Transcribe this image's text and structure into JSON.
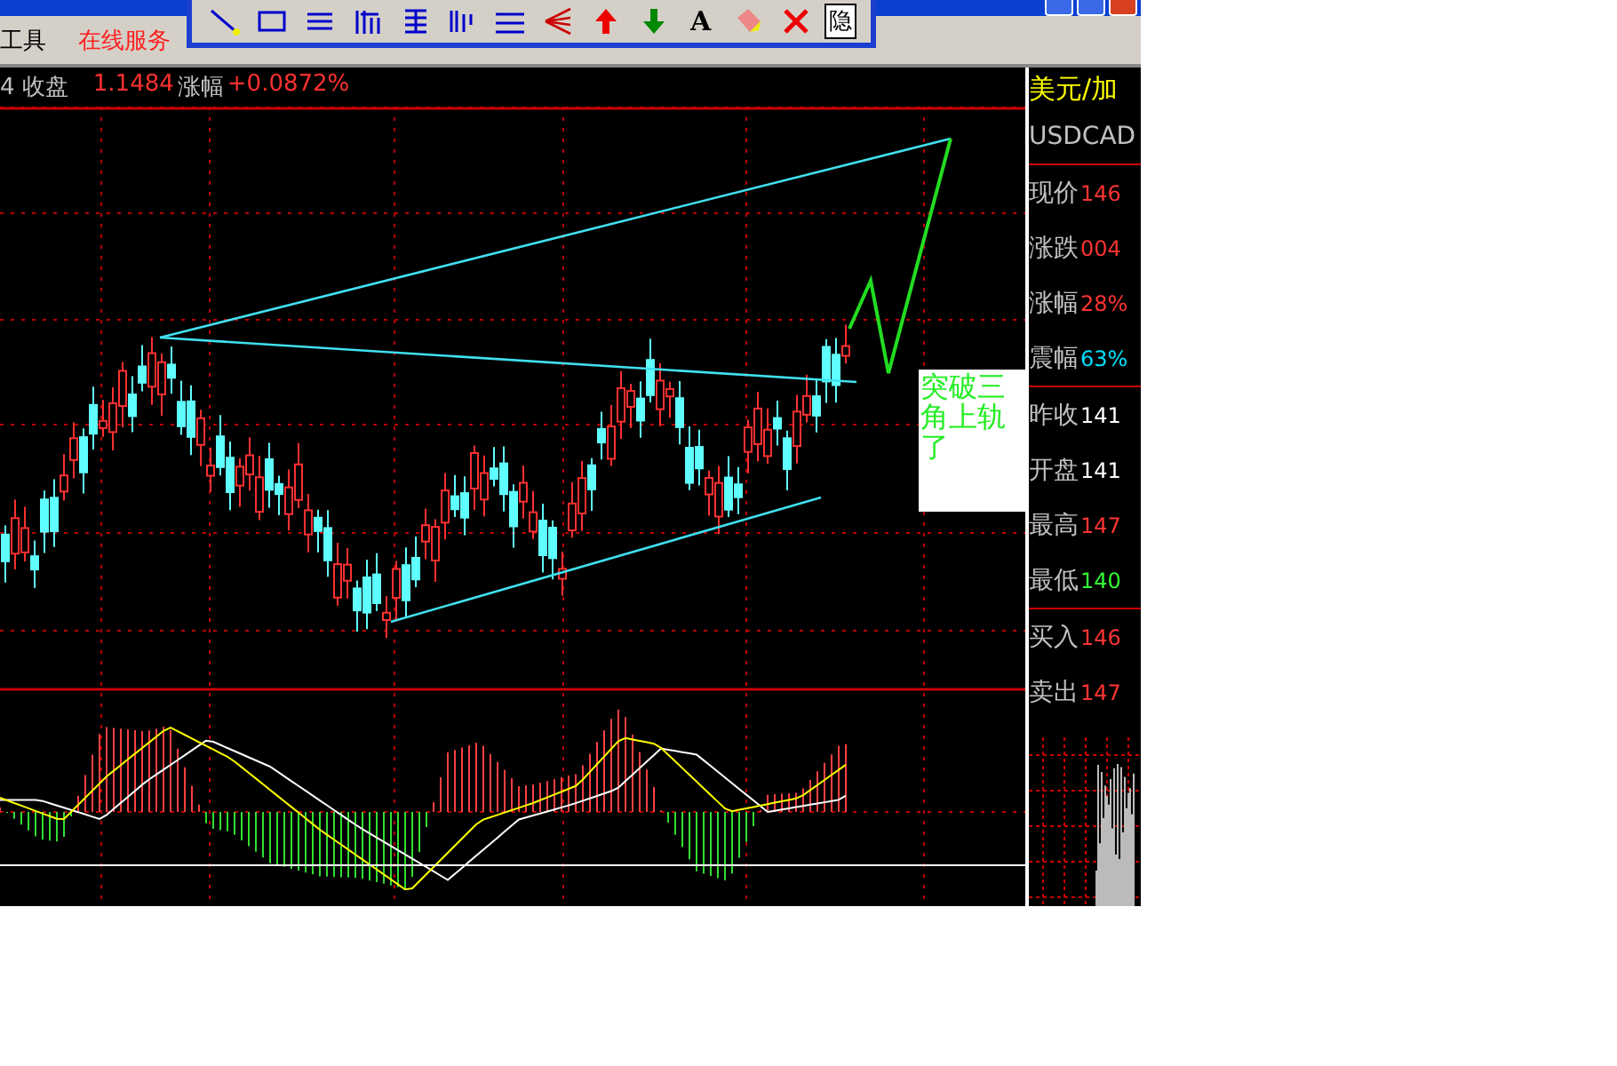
{
  "menu": [
    {
      "label": "工具",
      "kind": "normal"
    },
    {
      "label": "在线服务",
      "kind": "highlight"
    }
  ],
  "toolbar": {
    "text_buttons": [
      "A",
      "隐"
    ]
  },
  "quote_bar": {
    "label": "4 收盘",
    "price": "1.1484",
    "change_label": "涨幅",
    "change": "+0.0872%"
  },
  "annotation": {
    "text": "突破三角上轨了"
  },
  "symbol_panel": {
    "name": "美元/加",
    "code": "USDCAD",
    "rows": [
      {
        "label": "现价",
        "value": "146",
        "color": "#ff3333",
        "divider_after": false
      },
      {
        "label": "涨跌",
        "value": "004",
        "color": "#ff3333",
        "divider_after": false
      },
      {
        "label": "涨幅",
        "value": "28%",
        "color": "#ff3333",
        "divider_after": false
      },
      {
        "label": "震幅",
        "value": "63%",
        "color": "#00e0ff",
        "divider_after": true
      },
      {
        "label": "昨收",
        "value": "141",
        "color": "#ffffff",
        "divider_after": false
      },
      {
        "label": "开盘",
        "value": "141",
        "color": "#ffffff",
        "divider_after": false
      },
      {
        "label": "最高",
        "value": "147",
        "color": "#ff3333",
        "divider_after": false
      },
      {
        "label": "最低",
        "value": "140",
        "color": "#33ff33",
        "divider_after": true
      },
      {
        "label": "买入",
        "value": "146",
        "color": "#ff3333",
        "divider_after": false
      },
      {
        "label": "卖出",
        "value": "147",
        "color": "#ff3333",
        "divider_after": false
      }
    ]
  }
}
